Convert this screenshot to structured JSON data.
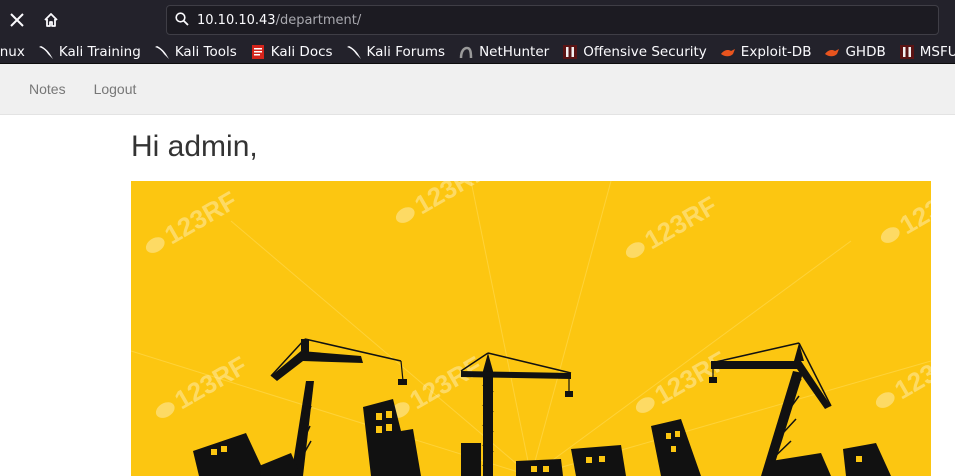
{
  "browser": {
    "url_host": "10.10.10.43",
    "url_path": "/department/",
    "bookmarks": [
      {
        "label": "inux",
        "icon": "kali-icon"
      },
      {
        "label": "Kali Training",
        "icon": "kali-dragon-icon"
      },
      {
        "label": "Kali Tools",
        "icon": "kali-dragon-icon"
      },
      {
        "label": "Kali Docs",
        "icon": "docs-icon"
      },
      {
        "label": "Kali Forums",
        "icon": "kali-dragon-icon"
      },
      {
        "label": "NetHunter",
        "icon": "nethunter-icon"
      },
      {
        "label": "Offensive Security",
        "icon": "offsec-icon"
      },
      {
        "label": "Exploit-DB",
        "icon": "exploitdb-icon"
      },
      {
        "label": "GHDB",
        "icon": "exploitdb-icon"
      },
      {
        "label": "MSFU",
        "icon": "offsec-icon"
      }
    ]
  },
  "navbar": {
    "notes_label": "Notes",
    "logout_label": "Logout"
  },
  "main": {
    "greeting": "Hi admin,"
  },
  "hero": {
    "watermark": "123RF",
    "background_color": "#fcc611",
    "silhouette_color": "#111111"
  }
}
